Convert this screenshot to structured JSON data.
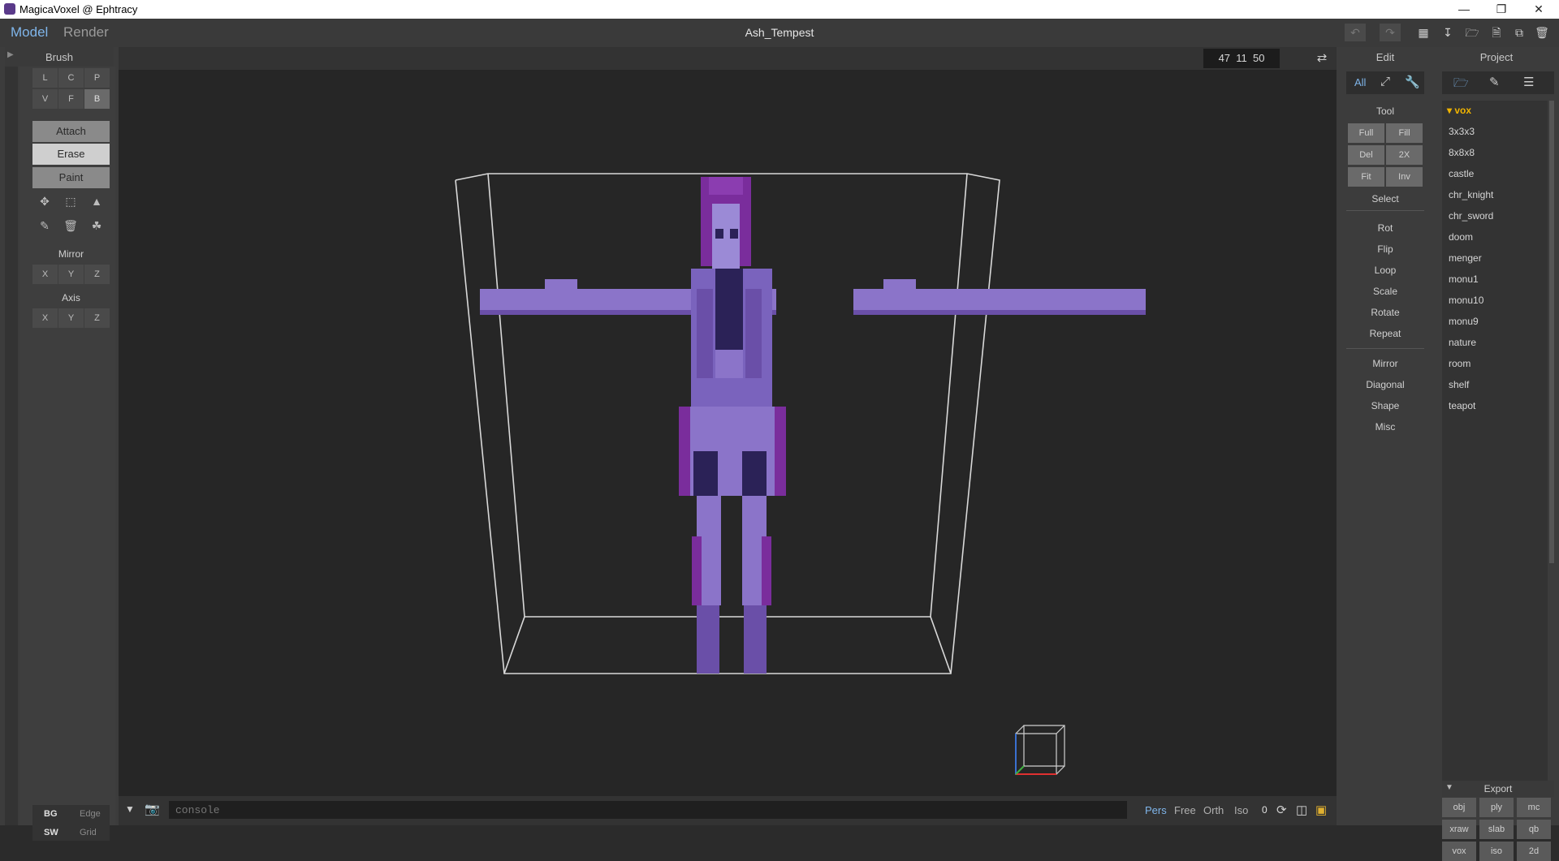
{
  "window": {
    "title": "MagicaVoxel @ Ephtracy"
  },
  "menubar": {
    "model": "Model",
    "render": "Render",
    "file_title": "Ash_Tempest"
  },
  "brush": {
    "header": "Brush",
    "modes_row1": [
      "L",
      "C",
      "P"
    ],
    "modes_row2": [
      "V",
      "F",
      "B"
    ],
    "actions": [
      "Attach",
      "Erase",
      "Paint"
    ],
    "mirror_label": "Mirror",
    "axis_label": "Axis",
    "mirror_axes": [
      "X",
      "Y",
      "Z"
    ],
    "axis_axes": [
      "X",
      "Y",
      "Z"
    ],
    "bottom": {
      "bg": "BG",
      "edge": "Edge",
      "sw": "SW",
      "grid": "Grid"
    }
  },
  "viewport": {
    "coords": "47  11  50",
    "console_placeholder": "console",
    "view_modes": [
      "Pers",
      "Free",
      "Orth",
      "Iso"
    ],
    "zoom_value": "0",
    "model_colors": {
      "light": "#8b74c9",
      "mid": "#6a4fa8",
      "dark": "#2b2257",
      "magenta": "#7a2d9c",
      "skin": "#9b8ad6"
    }
  },
  "edit": {
    "header": "Edit",
    "filter_all": "All",
    "tool_label": "Tool",
    "tool_buttons": [
      "Full",
      "Fill",
      "Del",
      "2X",
      "Fit",
      "Inv"
    ],
    "select_label": "Select",
    "group1": [
      "Rot",
      "Flip",
      "Loop",
      "Scale",
      "Rotate",
      "Repeat"
    ],
    "group2": [
      "Mirror",
      "Diagonal",
      "Shape",
      "Misc"
    ]
  },
  "project": {
    "header": "Project",
    "folder": "vox",
    "files": [
      "3x3x3",
      "8x8x8",
      "castle",
      "chr_knight",
      "chr_sword",
      "doom",
      "menger",
      "monu1",
      "monu10",
      "monu9",
      "nature",
      "room",
      "shelf",
      "teapot"
    ],
    "export_label": "Export",
    "export_formats": [
      "obj",
      "ply",
      "mc",
      "xraw",
      "slab",
      "qb",
      "vox",
      "iso",
      "2d"
    ]
  }
}
